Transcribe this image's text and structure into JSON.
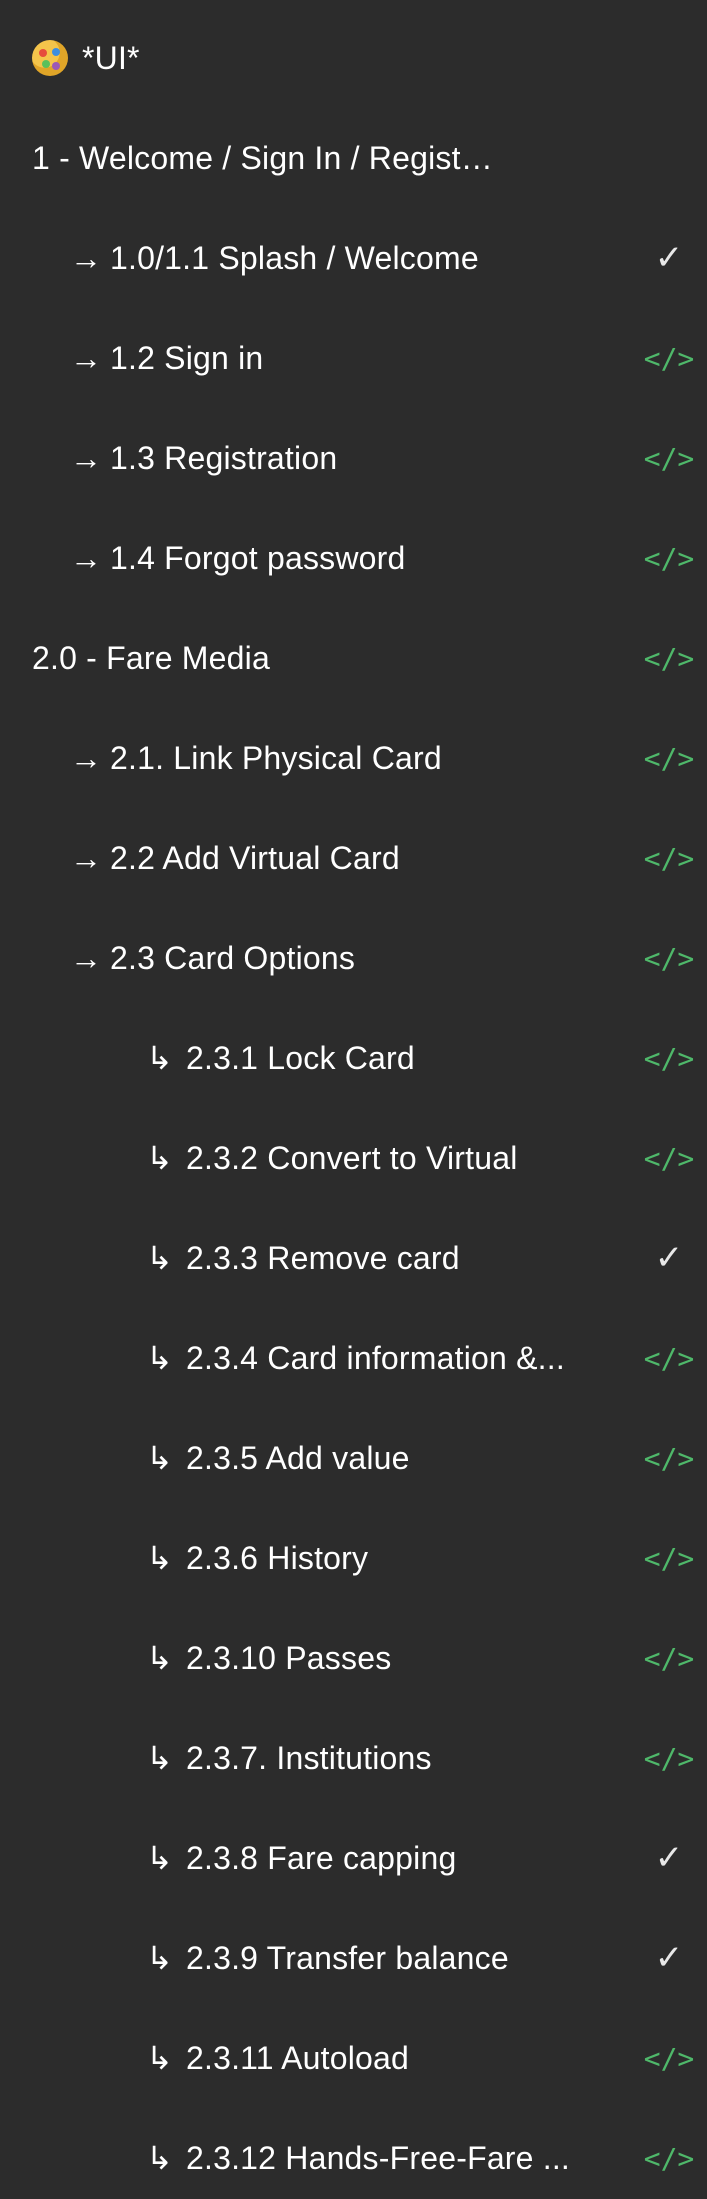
{
  "header": {
    "title": "*UI*",
    "icon": "palette-icon"
  },
  "colors": {
    "background": "#2c2c2c",
    "text": "#ffffff",
    "code_status": "#4fb86a",
    "check_status": "#e8e8e8"
  },
  "glyphs": {
    "arrow": "→",
    "sub_arrow": "↳",
    "code": "</>",
    "check": "✓"
  },
  "rows": [
    {
      "label": "1 - Welcome / Sign In / Registration",
      "status": ""
    },
    {
      "label": "1.0/1.1 Splash / Welcome",
      "status": "check"
    },
    {
      "label": "1.2 Sign in",
      "status": "code"
    },
    {
      "label": "1.3 Registration",
      "status": "code"
    },
    {
      "label": "1.4 Forgot password",
      "status": "code"
    },
    {
      "label": "2.0 - Fare Media",
      "status": "code"
    },
    {
      "label": "2.1. Link Physical Card",
      "status": "code"
    },
    {
      "label": "2.2 Add Virtual Card",
      "status": "code"
    },
    {
      "label": "2.3 Card Options",
      "status": "code"
    },
    {
      "label": "2.3.1 Lock Card",
      "status": "code"
    },
    {
      "label": "2.3.2 Convert to Virtual",
      "status": "code"
    },
    {
      "label": "2.3.3 Remove card",
      "status": "check"
    },
    {
      "label": "2.3.4 Card information &...",
      "status": "code"
    },
    {
      "label": "2.3.5 Add value",
      "status": "code"
    },
    {
      "label": "2.3.6 History",
      "status": "code"
    },
    {
      "label": "2.3.10 Passes",
      "status": "code"
    },
    {
      "label": "2.3.7. Institutions",
      "status": "code"
    },
    {
      "label": "2.3.8 Fare capping",
      "status": "check"
    },
    {
      "label": "2.3.9 Transfer balance",
      "status": "check"
    },
    {
      "label": "2.3.11 Autoload",
      "status": "code"
    },
    {
      "label": "2.3.12 Hands-Free-Fare ...",
      "status": "code"
    }
  ]
}
